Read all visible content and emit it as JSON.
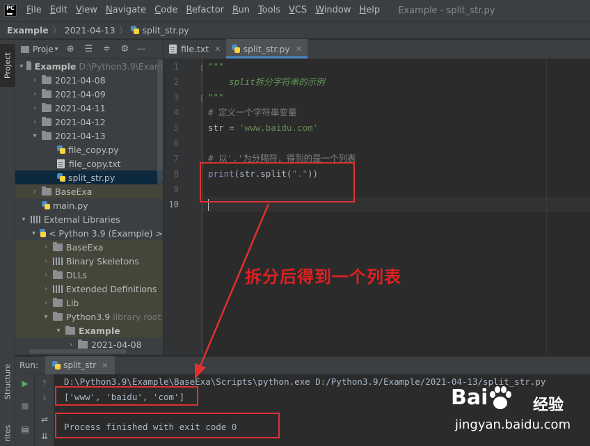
{
  "app": {
    "logo_text": "PC",
    "window_title": "Example - split_str.py"
  },
  "menu": {
    "items": [
      {
        "label": "File",
        "u": "F",
        "rest": "ile"
      },
      {
        "label": "Edit",
        "u": "E",
        "rest": "dit"
      },
      {
        "label": "View",
        "u": "V",
        "rest": "iew"
      },
      {
        "label": "Navigate",
        "u": "N",
        "rest": "avigate"
      },
      {
        "label": "Code",
        "u": "C",
        "rest": "ode"
      },
      {
        "label": "Refactor",
        "u": "R",
        "rest": "efactor"
      },
      {
        "label": "Run",
        "u": "R",
        "rest": "un"
      },
      {
        "label": "Tools",
        "u": "T",
        "rest": "ools"
      },
      {
        "label": "VCS",
        "u": "V",
        "rest": "CS"
      },
      {
        "label": "Window",
        "u": "W",
        "rest": "indow"
      },
      {
        "label": "Help",
        "u": "H",
        "rest": "elp"
      }
    ]
  },
  "breadcrumb": {
    "project": "Example",
    "folder": "2021-04-13",
    "file": "split_str.py"
  },
  "left_stripe": {
    "project_tab": "Project",
    "structure_tab": "Structure",
    "favorites_tab": "rites"
  },
  "project_panel": {
    "title": "Proje"
  },
  "tree": {
    "root_name": "Example",
    "root_path": "D:\\Python3.9\\Exam",
    "folder_0408": "2021-04-08",
    "folder_0409": "2021-04-09",
    "folder_0411": "2021-04-11",
    "folder_0412": "2021-04-12",
    "folder_0413": "2021-04-13",
    "file_copy_py": "file_copy.py",
    "file_copy_txt": "file_copy.txt",
    "split_str_py": "split_str.py",
    "baseexa": "BaseExa",
    "main_py": "main.py",
    "external_libraries": "External Libraries",
    "python_sdk": "< Python 3.9 (Example) >",
    "lib_baseexa": "BaseExa",
    "binary_skeletons": "Binary Skeletons",
    "dlls": "DLLs",
    "extended_definitions": "Extended Definitions",
    "lib": "Lib",
    "python39": "Python3.9",
    "library_root": "library root",
    "example_sub": "Example",
    "sub_0408": "2021-04-08"
  },
  "editor": {
    "tabs": [
      {
        "label": "file.txt",
        "close": "✕"
      },
      {
        "label": "split_str.py",
        "close": "✕"
      }
    ],
    "line_numbers": [
      "1",
      "2",
      "3",
      "4",
      "5",
      "6",
      "7",
      "8",
      "9",
      "10"
    ],
    "lines": {
      "l1": "\"\"\"",
      "l2": "    split拆分字符串的示例",
      "l3": "\"\"\"",
      "l4": "# 定义一个字符串变量",
      "l5_a": "str = ",
      "l5_b": "'www.baidu.com'",
      "l7": "# 以'.'为分隔符，得到的是一个列表",
      "l8_a": "print",
      "l8_b": "(str.split(",
      "l8_c": "\".\"",
      "l8_d": "))"
    }
  },
  "annotation": {
    "text": "拆分后得到一个列表"
  },
  "run_panel": {
    "label": "Run:",
    "tab": "split_str",
    "tab_close": "✕",
    "command": "D:\\Python3.9\\Example\\BaseExa\\Scripts\\python.exe D:/Python3.9/Example/2021-04-13/split_str.py",
    "output": "['www', 'baidu', 'com']",
    "exit_message": "Process finished with exit code 0"
  },
  "watermark": {
    "brand_a": "Bai",
    "brand_b": "",
    "brand_cn": "经验",
    "url": "jingyan.baidu.com"
  },
  "colors": {
    "accent": "#4a88c7",
    "annotation": "#e03131",
    "string": "#6a8759",
    "comment": "#808080",
    "docstring": "#629755"
  }
}
